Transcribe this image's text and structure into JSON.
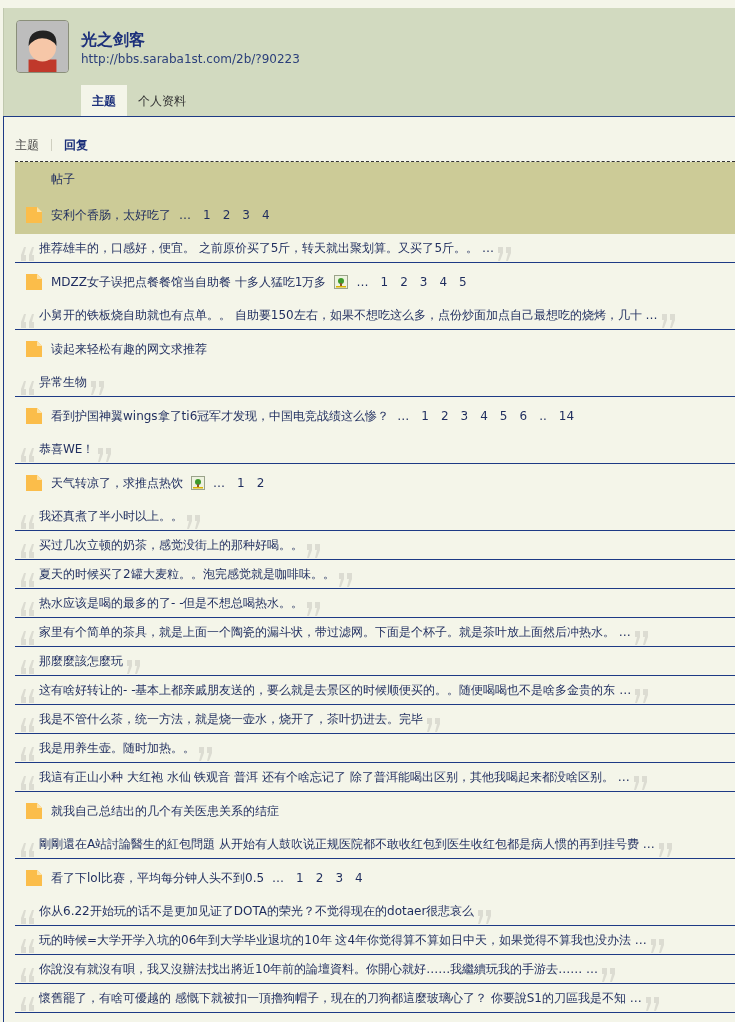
{
  "profile": {
    "name": "光之剑客",
    "url": "http://bbs.saraba1st.com/2b/?90223"
  },
  "tabs": [
    {
      "label": "主题",
      "selected": true
    },
    {
      "label": "个人资料",
      "selected": false
    }
  ],
  "subtabs": [
    {
      "label": "主题",
      "selected": false
    },
    {
      "label": "回复",
      "selected": true
    }
  ],
  "table_header": "帖子",
  "threads": [
    {
      "title": "安利个香肠，太好吃了",
      "has_image": false,
      "ellipsis": "…",
      "pages": [
        "1",
        "2",
        "3",
        "4"
      ],
      "selected": true,
      "replies": [
        "推荐雄丰的，口感好，便宜。 之前原价买了5斤，转天就出聚划算。又买了5斤。。 …"
      ]
    },
    {
      "title": "MDZZ女子误把点餐餐馆当自助餐 十多人猛吃1万多",
      "has_image": true,
      "ellipsis": "…",
      "pages": [
        "1",
        "2",
        "3",
        "4",
        "5"
      ],
      "selected": false,
      "replies": [
        "小舅开的铁板烧自助就也有点单。。 自助要150左右，如果不想吃这么多，点份炒面加点自己最想吃的烧烤，几十 …"
      ]
    },
    {
      "title": "读起来轻松有趣的网文求推荐",
      "has_image": false,
      "selected": false,
      "replies": [
        "异常生物"
      ]
    },
    {
      "title": "看到护国神翼wings拿了ti6冠军才发现，中国电竞战绩这么惨？",
      "has_image": false,
      "ellipsis": "…",
      "pages": [
        "1",
        "2",
        "3",
        "4",
        "5",
        "6",
        "..",
        "14"
      ],
      "selected": false,
      "replies": [
        "恭喜WE！"
      ]
    },
    {
      "title": "天气转凉了，求推点热饮",
      "has_image": true,
      "ellipsis": "…",
      "pages": [
        "1",
        "2"
      ],
      "selected": false,
      "replies": [
        "我还真煮了半小时以上。。",
        "买过几次立顿的奶茶，感觉没街上的那种好喝。。",
        "夏天的时候买了2罐大麦粒。。泡完感觉就是咖啡味。。",
        "热水应该是喝的最多的了- -但是不想总喝热水。。",
        "家里有个简单的茶具，就是上面一个陶瓷的漏斗状，带过滤网。下面是个杯子。就是茶叶放上面然后冲热水。 …",
        "那麼麼該怎麼玩",
        "这有啥好转让的- -基本上都亲戚朋友送的，要么就是去景区的时候顺便买的。。随便喝喝也不是啥多金贵的东 …",
        "我是不管什么茶，统一方法，就是烧一壶水，烧开了，茶叶扔进去。完毕",
        "我是用养生壶。随时加热。。",
        "我這有正山小种 大红袍 水仙 铁观音 普洱 还有个啥忘记了 除了普洱能喝出区别，其他我喝起来都没啥区别。 …"
      ]
    },
    {
      "title": "就我自己总结出的几个有关医患关系的结症",
      "has_image": false,
      "selected": false,
      "replies": [
        "剛剛還在A站討論醫生的紅包問題 从开始有人鼓吹说正规医院都不敢收红包到医生收红包都是病人惯的再到挂号费 …"
      ]
    },
    {
      "title": "看了下lol比赛，平均每分钟人头不到0.5",
      "has_image": false,
      "ellipsis": "…",
      "pages": [
        "1",
        "2",
        "3",
        "4"
      ],
      "selected": false,
      "replies": [
        "你从6.22开始玩的话不是更加见证了DOTA的荣光？不觉得现在的dotaer很悲哀么",
        "玩的時候=大学开学入坑的06年到大学毕业退坑的10年 这4年你觉得算不算如日中天，如果觉得不算我也没办法 …",
        "你說沒有就沒有唄，我又沒辦法找出將近10年前的論壇資料。你開心就好……我繼續玩我的手游去…… …",
        "懷舊罷了，有啥可優越的 感慨下就被扣一頂擼狗帽子，現在的刀狗都這麼玻璃心了？ 你要說S1的刀區我是不知 …"
      ]
    }
  ]
}
